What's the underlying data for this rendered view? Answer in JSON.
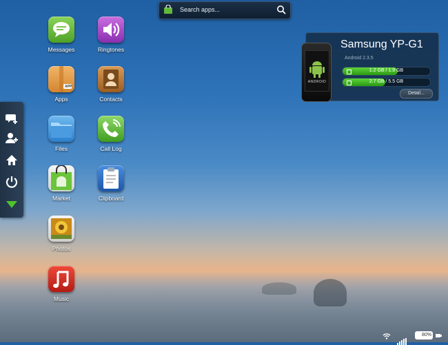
{
  "search": {
    "placeholder": "Search apps..."
  },
  "sidebar": {
    "items": [
      "new-message",
      "add-contact",
      "home",
      "power",
      "download"
    ]
  },
  "apps": [
    {
      "label": "Messages"
    },
    {
      "label": "Ringtones"
    },
    {
      "label": "Apps",
      "badge": "APP"
    },
    {
      "label": "Contacts"
    },
    {
      "label": "Files"
    },
    {
      "label": "Call Log"
    },
    {
      "label": "Market"
    },
    {
      "label": "Clipboard"
    },
    {
      "label": "Photos"
    },
    {
      "label": "Music"
    }
  ],
  "device": {
    "name": "Samsung YP-G1",
    "os": "Android 2.3.5",
    "phone_logo": "ANDROID",
    "storage": [
      {
        "label": "1.2 GB / 1.9 GB",
        "used": 0.63
      },
      {
        "label": "2.7 GB / 5.5 GB",
        "used": 0.49
      }
    ],
    "detail_label": "Detail..."
  },
  "status": {
    "battery": "80%"
  }
}
